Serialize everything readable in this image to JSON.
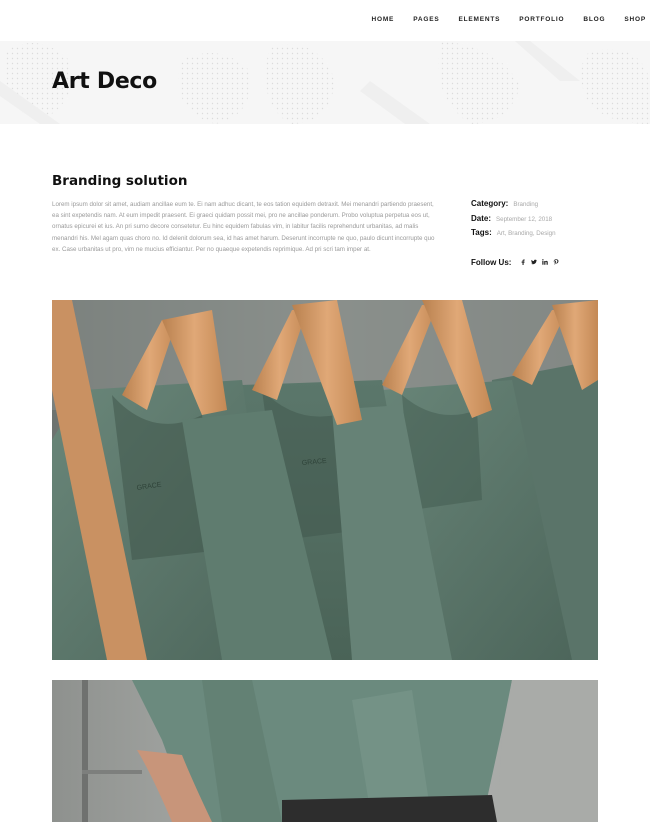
{
  "nav": {
    "items": [
      "HOME",
      "PAGES",
      "ELEMENTS",
      "PORTFOLIO",
      "BLOG",
      "SHOP"
    ]
  },
  "header": {
    "title": "Art Deco"
  },
  "content": {
    "heading": "Branding solution",
    "body": "Lorem ipsum dolor sit amet, audiam ancillae eum te. Ei nam adhuc dicant, te eos tation equidem detraxit. Mei menandri partiendo praesent, ea sint expetendis nam. At eum impedit praesent. Ei graeci quidam possit mei, pro ne ancillae ponderum. Probo voluptua perpetua eos ut, ornatus epicurei et ius. An pri sumo decore consetetur. Eu hinc equidem fabulas vim, in labitur facilis reprehendunt urbanitas, ad malis menandri his. Mel agam quas choro no. Id delenit dolorum sea, id has amet harum. Deserunt incorrupte ne quo, paulo dicunt incorrupte quo ex. Case urbanitas ut pro, vim ne mucius efficiantur. Per no quaeque expetendis reprimique. Ad pri scri tam imper at."
  },
  "meta": {
    "category_label": "Category:",
    "category_value": "Branding",
    "date_label": "Date:",
    "date_value": "September 12, 2018",
    "tags_label": "Tags:",
    "tags_value": "Art, Branding, Design",
    "follow_label": "Follow Us:",
    "social": [
      "facebook-icon",
      "twitter-icon",
      "linkedin-icon",
      "pinterest-icon"
    ]
  },
  "colors": {
    "background": "#ffffff",
    "band": "#f6f6f6",
    "text_dark": "#111111",
    "text_muted": "#9a9a9a"
  }
}
